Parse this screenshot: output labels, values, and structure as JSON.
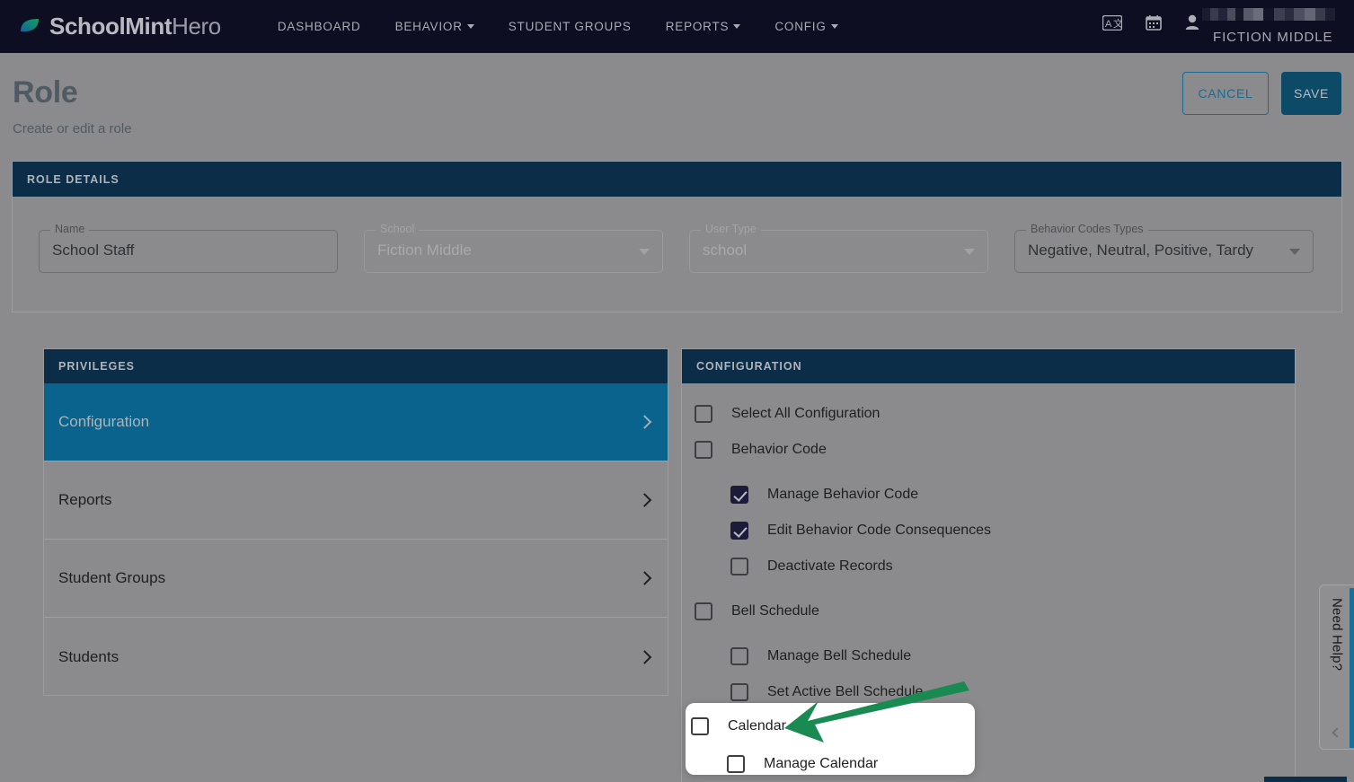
{
  "topnav": {
    "brand_bold": "SchoolMint",
    "brand_light": "Hero",
    "logo_icon": "leaf-icon",
    "links": [
      {
        "label": "DASHBOARD",
        "caret": false
      },
      {
        "label": "BEHAVIOR",
        "caret": true
      },
      {
        "label": "STUDENT GROUPS",
        "caret": false
      },
      {
        "label": "REPORTS",
        "caret": true
      },
      {
        "label": "CONFIG",
        "caret": true
      }
    ],
    "icons": [
      "translate-icon",
      "calendar-icon",
      "user-icon"
    ],
    "user_name_redacted": "",
    "school_name": "FICTION MIDDLE"
  },
  "page": {
    "title": "Role",
    "subtitle": "Create or edit a role",
    "cancel_label": "CANCEL",
    "save_label": "SAVE"
  },
  "role_details": {
    "header": "ROLE DETAILS",
    "fields": [
      {
        "label": "Name",
        "value": "School Staff",
        "type": "text",
        "disabled": false
      },
      {
        "label": "School",
        "value": "Fiction Middle",
        "type": "select",
        "disabled": true
      },
      {
        "label": "User Type",
        "value": "school",
        "type": "select",
        "disabled": true
      },
      {
        "label": "Behavior Codes Types",
        "value": "Negative, Neutral, Positive, Tardy",
        "type": "select",
        "disabled": false
      }
    ]
  },
  "privileges": {
    "header": "PRIVILEGES",
    "items": [
      {
        "label": "Configuration",
        "active": true
      },
      {
        "label": "Reports",
        "active": false
      },
      {
        "label": "Student Groups",
        "active": false
      },
      {
        "label": "Students",
        "active": false
      }
    ]
  },
  "configuration": {
    "header": "CONFIGURATION",
    "rows": [
      {
        "label": "Select All Configuration",
        "level": 1,
        "checked": false
      },
      {
        "label": "Behavior Code",
        "level": 1,
        "checked": false
      },
      {
        "label": "Manage Behavior Code",
        "level": 2,
        "checked": true
      },
      {
        "label": "Edit Behavior Code Consequences",
        "level": 2,
        "checked": true
      },
      {
        "label": "Deactivate Records",
        "level": 2,
        "checked": false
      },
      {
        "label": "Bell Schedule",
        "level": 1,
        "checked": false
      },
      {
        "label": "Manage Bell Schedule",
        "level": 2,
        "checked": false
      },
      {
        "label": "Set Active Bell Schedule",
        "level": 2,
        "checked": false
      }
    ]
  },
  "callout": {
    "rows": [
      {
        "label": "Calendar",
        "level": 1,
        "checked": false
      },
      {
        "label": "Manage Calendar",
        "level": 2,
        "checked": false
      }
    ],
    "arrow_color": "#1a8a53"
  },
  "help_tab": {
    "label": "Need Help?"
  },
  "colors": {
    "nav_bg": "#0d0e21",
    "panel_header": "#0b2d47",
    "accent_active": "#09638c",
    "save_bg": "#0d4a68",
    "page_overlay": "#8b8b8d",
    "checkbox_checked": "#1c1b3a",
    "scrollbar": "#1b6f96"
  }
}
